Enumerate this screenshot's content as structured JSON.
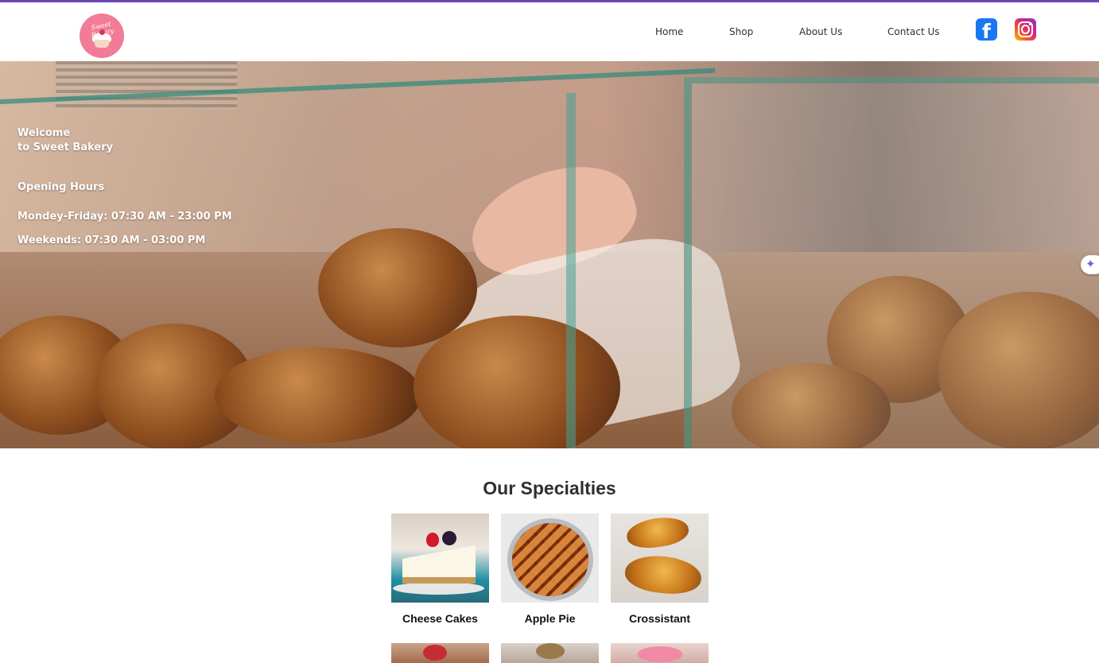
{
  "header": {
    "logo_text": "Sweet Bakery",
    "nav": [
      "Home",
      "Shop",
      "About Us",
      "Contact Us"
    ],
    "social": [
      "facebook-icon",
      "instagram-icon"
    ]
  },
  "hero": {
    "welcome_line1": "Welcome",
    "welcome_line2": "to Sweet Bakery",
    "hours_title": "Opening Hours",
    "weekday_hours": "Mondey-Friday: 07:30 AM - 23:00 PM",
    "weekend_hours": "Weekends: 07:30 AM - 03:00 PM"
  },
  "specialties": {
    "title": "Our Specialties",
    "items": [
      "Cheese Cakes",
      "Apple Pie",
      "Crossistant"
    ]
  },
  "colors": {
    "accent": "#6b46b8",
    "facebook": "#1877f2",
    "logo_pink": "#f27c97"
  }
}
